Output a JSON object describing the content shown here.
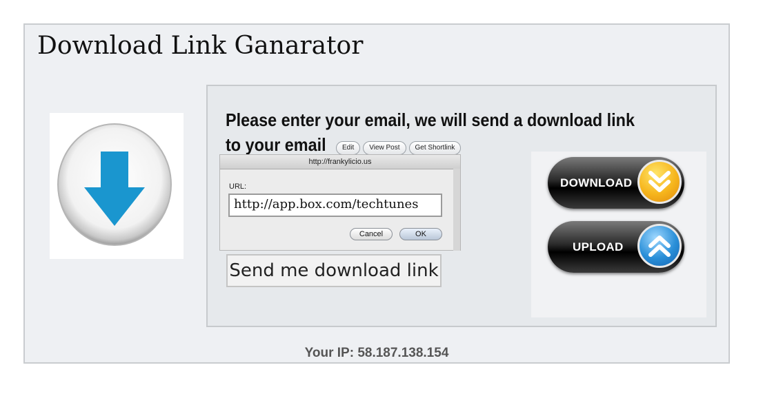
{
  "page": {
    "title": "Download Link Ganarator",
    "prompt": "Please enter your email, we will send a download link to your email",
    "send_button": "Send me download link",
    "ip_text": "Your IP: 58.187.138.154"
  },
  "dialog": {
    "toolbar": [
      "Edit",
      "View Post",
      "Get Shortlink"
    ],
    "title": "http://frankylicio.us",
    "url_label": "URL:",
    "url_value": "http://app.box.com/techtunes",
    "cancel": "Cancel",
    "ok": "OK"
  },
  "actions": {
    "download_label": "DOWNLOAD",
    "upload_label": "UPLOAD"
  },
  "icons": {
    "big_arrow": "download-arrow-icon",
    "download_chevrons": "chevron-double-down-icon",
    "upload_chevrons": "chevron-double-up-icon"
  },
  "colors": {
    "arrow_blue": "#1a96cf",
    "download_orange": "#f6b51c",
    "upload_blue": "#2a8fd8"
  }
}
